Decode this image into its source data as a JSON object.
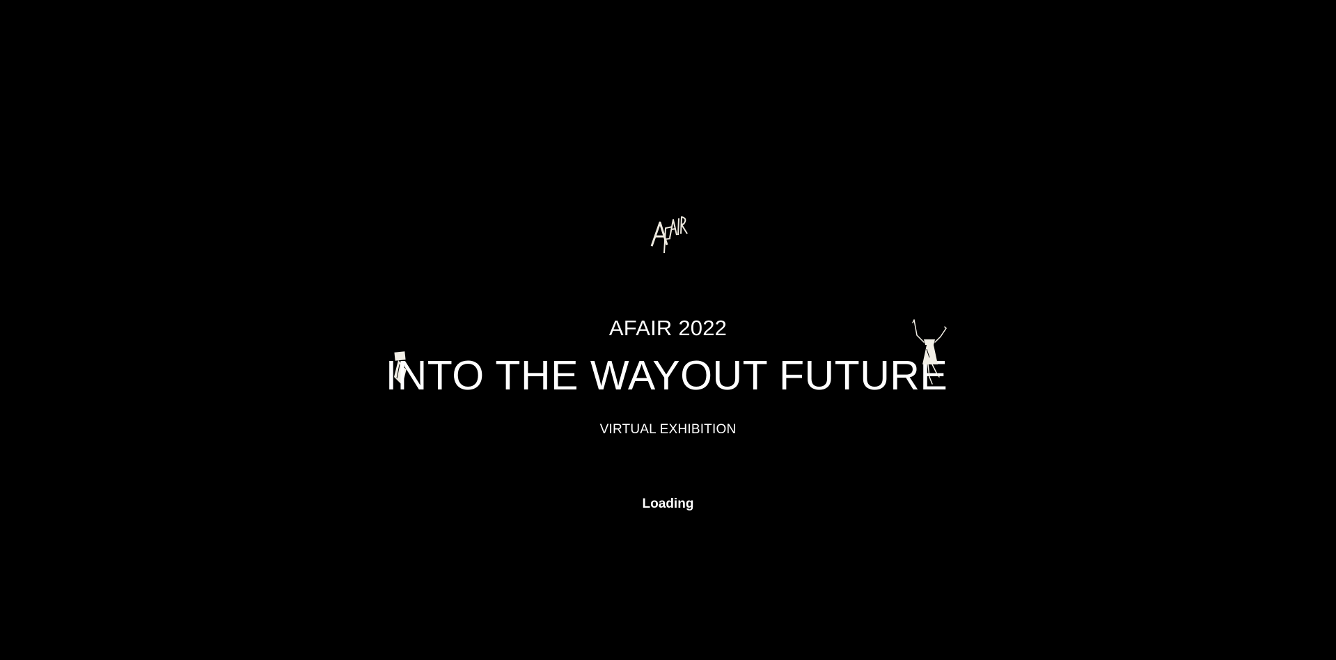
{
  "logo": {
    "icon": "afair-logo-icon",
    "text": "AFAIR"
  },
  "header": {
    "year_label": "AFAIR 2022",
    "title": "INTO THE WAYOUT FUTURE",
    "subtitle": "VIRTUAL EXHIBITION"
  },
  "status": {
    "loading_text": "Loading"
  },
  "decorations": {
    "left_figure_icon": "paper-figure-icon",
    "right_figure_icon": "dancing-figure-icon"
  },
  "colors": {
    "background": "#000000",
    "text": "#ffffff",
    "figure_fill": "#f2efe6"
  }
}
